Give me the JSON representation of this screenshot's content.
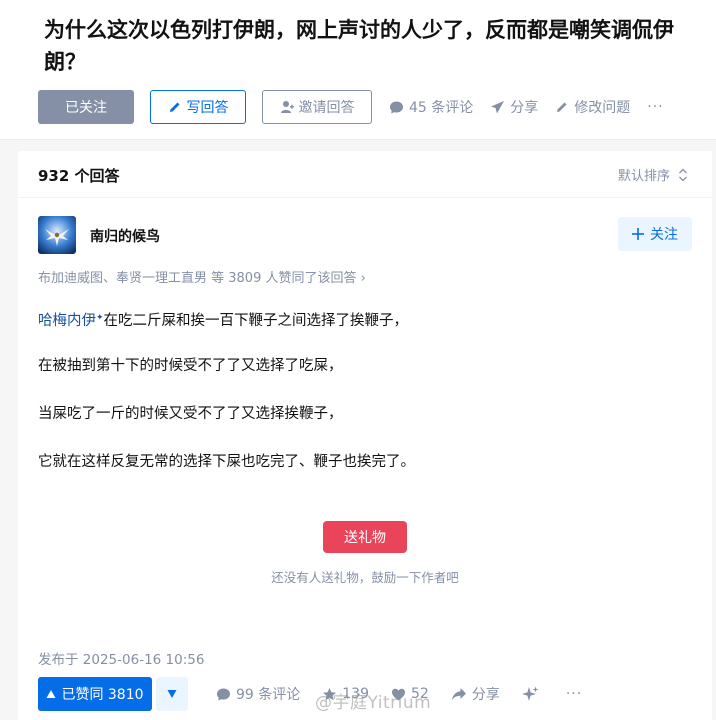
{
  "question": {
    "title": "为什么这次以色列打伊朗，网上声讨的人少了，反而都是嘲笑调侃伊朗？",
    "followed_label": "已关注",
    "write_label": "写回答",
    "invite_label": "邀请回答",
    "comments_label": "45 条评论",
    "share_label": "分享",
    "edit_label": "修改问题",
    "more_label": "···"
  },
  "answers_header": {
    "count_label": "932 个回答",
    "sort_label": "默认排序"
  },
  "answer": {
    "author": "南归的候鸟",
    "follow_label": "关注",
    "voters_text": "布加迪威图、奉贤一理工直男 等 3809 人赞同了该回答 ›",
    "mention_name": "哈梅内伊",
    "mention_mark": "✦",
    "line1_rest": "在吃二斤屎和挨一百下鞭子之间选择了挨鞭子，",
    "line2": "在被抽到第十下的时候受不了了又选择了吃屎，",
    "line3": "当屎吃了一斤的时候又受不了了又选择挨鞭子，",
    "line4": "它就在这样反复无常的选择下屎也吃完了、鞭子也挨完了。",
    "gift_label": "送礼物",
    "gift_note": "还没有人送礼物，鼓励一下作者吧",
    "published": "发布于 2025-06-16 10:56"
  },
  "actions": {
    "upvote_label": "已赞同 3810",
    "comments_label": "99 条评论",
    "favorites_label": "139",
    "likes_label": "52",
    "share_label": "分享",
    "more_label": "···"
  },
  "watermark": "@宇庭Yitrium",
  "colors": {
    "brand_blue": "#056de8",
    "muted": "#8590a6",
    "gift_red": "#e9445a"
  }
}
